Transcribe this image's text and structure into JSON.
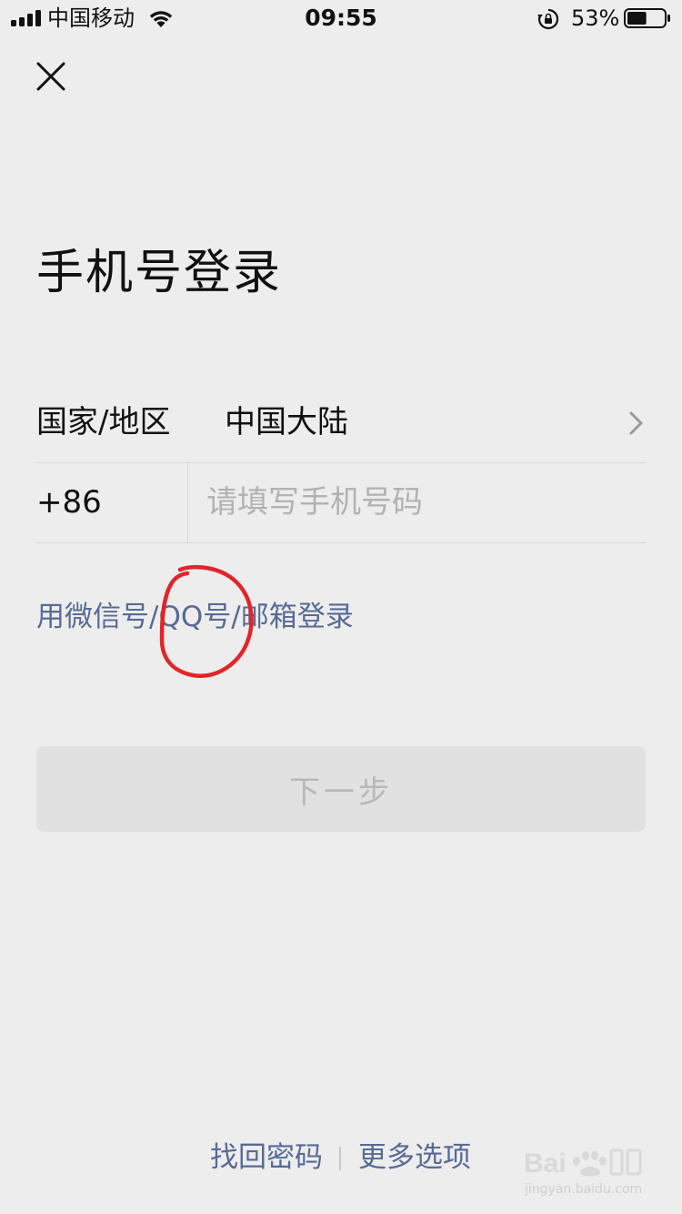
{
  "status_bar": {
    "carrier": "中国移动",
    "time": "09:55",
    "battery_percent": "53%",
    "battery_level": 0.53,
    "icons": [
      "signal-icon",
      "wifi-icon",
      "rotation-lock-icon",
      "battery-icon"
    ]
  },
  "header": {
    "close_icon": "close-icon"
  },
  "page": {
    "title": "手机号登录"
  },
  "form": {
    "region_label": "国家/地区",
    "region_value": "中国大陆",
    "region_icon": "chevron-right-icon",
    "country_code": "+86",
    "phone_value": "",
    "phone_placeholder": "请填写手机号码"
  },
  "alt_login": {
    "label": "用微信号/QQ号/邮箱登录"
  },
  "actions": {
    "next_label": "下一步",
    "next_enabled": false
  },
  "footer": {
    "recover_label": "找回密码",
    "more_label": "更多选项"
  },
  "watermark": {
    "text": "jingyan.baidu.com",
    "logo_icon": "baidu-jingyan-logo"
  },
  "annotation": {
    "color": "#e0262a",
    "shape": "hand-drawn-circle"
  },
  "colors": {
    "background": "#ededed",
    "link": "#576b95",
    "text": "#111111",
    "placeholder": "#b2b2b2",
    "button_disabled_bg": "#e1e1e1",
    "button_disabled_text": "#b8b8b8"
  }
}
